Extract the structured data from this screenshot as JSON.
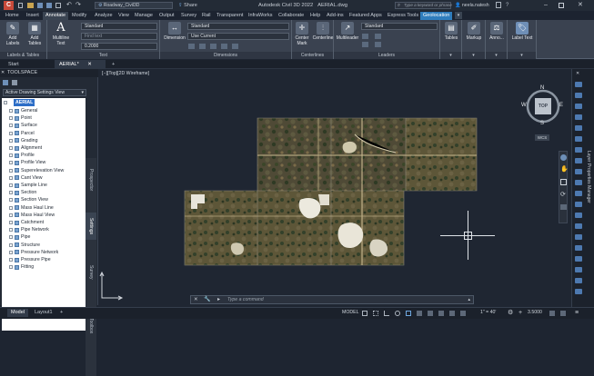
{
  "titlebar": {
    "workspace": "Roadway_Civil3D",
    "share": "Share",
    "app_title": "Autodesk Civil 3D 2022",
    "file": "AERIAL.dwg",
    "search_placeholder": "Type a keyword or phrase",
    "user": "neela.natesh"
  },
  "ribbon_tabs": [
    "Home",
    "Insert",
    "Annotate",
    "Modify",
    "Analyze",
    "View",
    "Manage",
    "Output",
    "Survey",
    "Rail",
    "Transparent",
    "InfraWorks",
    "Collaborate",
    "Help",
    "Add-ins",
    "Featured Apps",
    "Express Tools",
    "Geolocation"
  ],
  "ribbon": {
    "labels_tables": {
      "add_labels": "Add Labels",
      "add_tables": "Add Tables",
      "title": "Labels & Tables"
    },
    "text": {
      "multiline": "Multiline Text",
      "style": "Standard",
      "find": "Find text",
      "height": "0.2000",
      "title": "Text"
    },
    "dimensions": {
      "dimension": "Dimension",
      "style": "Standard",
      "layer": "Use Current",
      "title": "Dimensions"
    },
    "centerlines": {
      "center_mark": "Center Mark",
      "centerline": "Centerline",
      "title": "Centerlines"
    },
    "leaders": {
      "multileader": "Multileader",
      "style": "Standard",
      "title": "Leaders"
    },
    "tables": {
      "label": "Tables"
    },
    "markup": {
      "label": "Markup"
    },
    "annotation": {
      "label": "Anno..."
    },
    "label_text": {
      "label": "Label Text"
    }
  },
  "doc_tabs": {
    "start": "Start",
    "active": "AERIAL*",
    "add": "+"
  },
  "toolspace": {
    "title": "TOOLSPACE",
    "view": "Active Drawing Settings View",
    "root": "AERIAL",
    "items": [
      "General",
      "Point",
      "Surface",
      "Parcel",
      "Grading",
      "Alignment",
      "Profile",
      "Profile View",
      "Superelevation View",
      "Cant View",
      "Sample Line",
      "Section",
      "Section View",
      "Mass Haul Line",
      "Mass Haul View",
      "Catchment",
      "Pipe Network",
      "Pipe",
      "Structure",
      "Pressure Network",
      "Pressure Pipe",
      "Fitting"
    ],
    "side_tabs": [
      "Prospector",
      "Settings",
      "Survey",
      "Toolbox"
    ]
  },
  "viewport": {
    "label": "[−][Top][2D Wireframe]"
  },
  "viewcube": {
    "top": "TOP",
    "n": "N",
    "s": "S",
    "e": "E",
    "w": "W",
    "wcs": "WCS"
  },
  "command": {
    "placeholder": "Type a command"
  },
  "right_panel": {
    "label": "Layer Properties Manager"
  },
  "status": {
    "model_tab": "Model",
    "layout": "Layout1",
    "model": "MODEL",
    "scale": "1\" = 40'",
    "value": "3.5000"
  },
  "colors": {
    "accent": "#2f7dbd",
    "ribbon": "#3a4250"
  }
}
